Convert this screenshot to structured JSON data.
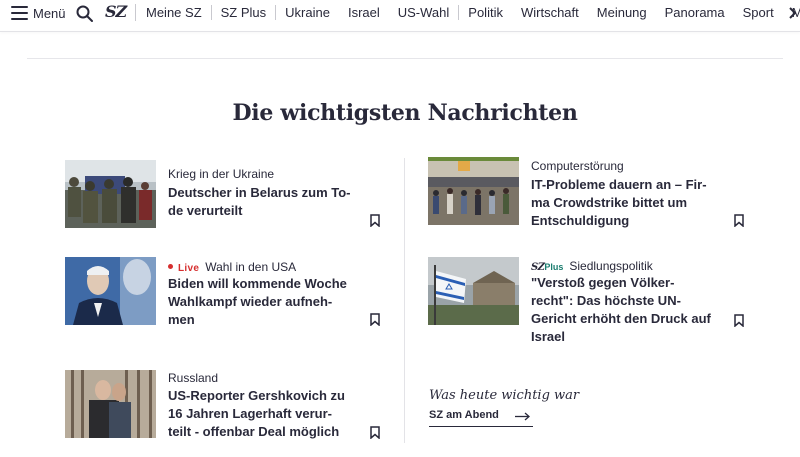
{
  "header": {
    "menu_label": "Menü",
    "logo": "SZ",
    "nav_items": [
      {
        "label": "Meine SZ"
      },
      {
        "label": "SZ Plus"
      },
      {
        "label": "Ukraine"
      },
      {
        "label": "Israel"
      },
      {
        "label": "US-Wahl"
      },
      {
        "label": "Politik"
      },
      {
        "label": "Wirtschaft"
      },
      {
        "label": "Meinung"
      },
      {
        "label": "Panorama"
      },
      {
        "label": "Sport"
      },
      {
        "label": "Müncher"
      }
    ],
    "more_icon": "chevron-right-icon"
  },
  "section": {
    "title": "Die wichtigsten Nachrichten"
  },
  "teasers": {
    "t1": {
      "kicker": "Krieg in der Ukraine",
      "line1": "Deutscher in Belarus zum To-",
      "line2": "de verurteilt"
    },
    "t2": {
      "live": "Live",
      "kicker": "Wahl in den USA",
      "line1": "Biden will kommende Woche",
      "line2": "Wahlkampf wieder aufneh-",
      "line3": "men"
    },
    "t3": {
      "kicker": "Russland",
      "line1": "US-Reporter Gershkovich zu",
      "line2": "16 Jahren Lagerhaft verur-",
      "line3": "teilt - offenbar Deal möglich"
    },
    "t4": {
      "kicker": "Computerstörung",
      "line1": "IT-Probleme dauern an – Fir-",
      "line2": "ma Crowdstrike bittet um",
      "line3": "Entschuldigung"
    },
    "t5": {
      "badge_sz": "SZ",
      "badge_plus": "Plus",
      "kicker": "Siedlungspolitik",
      "line1": "\"Verstoß gegen Völker-",
      "line2": "recht\": Das höchste UN-",
      "line3": "Gericht erhöht den Druck auf",
      "line4": "Israel"
    }
  },
  "evening": {
    "title": "Was heute wichtig war",
    "link": "SZ am Abend"
  },
  "colors": {
    "text": "#29293a",
    "live": "#d62f2f",
    "plus": "#1a7d6f"
  }
}
